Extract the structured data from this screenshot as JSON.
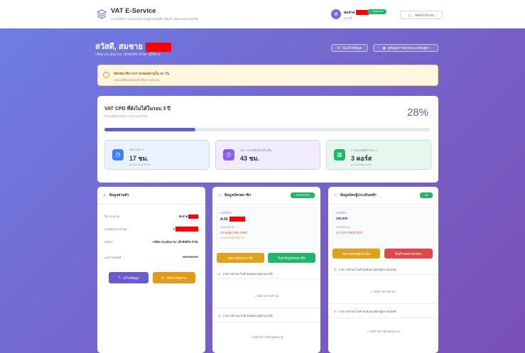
{
  "header": {
    "brand_title": "VAT E-Service",
    "brand_subtitle": "ระบบให้บริการออนไลน์สมาคมผู้สอบบัญชีภาษีมูลค่าเพิ่มแห่งประเทศไทย",
    "user_initial": "ส",
    "user_name": "สมชาย",
    "approved_badge": "✓ Approved",
    "user_role": "สมาชิก",
    "logout_label": "ออกจากระบบ"
  },
  "hero": {
    "greeting": "สวัสดี, สมชาย",
    "subtitle": "บริษัท ประเมินภาษา เอ็กซ์เพิร์ท จำกัด • ผู้ใช้งาน",
    "edit_btn": "ไปแก้ไขข้อมูล",
    "history_btn": "ดูข้อมูลการอบรมและหลักสูตร"
  },
  "alert": {
    "title": "บัตรสมาชิก VAT จะหมดอายุใน 62 วัน",
    "subtitle": "กรุณาเตรียมต่ออายุสำหรับการต่ออายุ"
  },
  "cpd": {
    "title": "VAT CPD ที่ยังไม่ได้ในรอบ 3 ปี",
    "subtitle": "ชั่วโมงที่สะสมได้ 17 จาก 60 ชั่วโมง",
    "percent_label": "28%",
    "progress_fraction": 0.28,
    "stats": [
      {
        "label": "VAT CPD ↗",
        "value": "17 ชม.",
        "note": "ดูรายละเอียดชั่วโมง"
      },
      {
        "label": "VAT CPD ที่ยังต้องเก็บเพิ่ม",
        "value": "43 ชม.",
        "note": ""
      },
      {
        "label": "การอบรมที่เข้าร่วม ↗",
        "value": "3 คอร์ส",
        "note": "ดูรายละเอียดคอร์ส"
      }
    ]
  },
  "personal": {
    "title": "ข้อมูลส่วนตัว",
    "rows": [
      {
        "label": "ชื่อ-นามสกุล",
        "value": "สมชาย"
      },
      {
        "label": "เลขบัตรประชาชน",
        "value": "3"
      },
      {
        "label": "องค์กร",
        "value": "บริษัท ประเมินภาษา เอ็กซ์เพิร์ท จำกัด"
      },
      {
        "label": "เบอร์โทรศัพท์",
        "value": "0899999999"
      }
    ],
    "edit_btn": "แก้ไขข้อมูล",
    "password_btn": "เปลี่ยนรหัสผ่าน"
  },
  "membership": {
    "title": "ข้อมูลบัตรสมาชิก",
    "status_pill": "APPROVED",
    "member_no_label": "เลขที่บัตร",
    "member_no": "A-65",
    "expiry_label": "วันหมดอายุ",
    "expiry": "10 พฤษภาคม 2569",
    "expiry_note": "จะหมดอายุใน 62 วัน",
    "renew_btn": "ต่ออายุบัตรสมาชิก",
    "print_btn": "ใบสำคัญบัตรสมาชิก",
    "history1": "รายการคำขอ ใบคำขอต่ออายุบัตรสมาชิก",
    "empty1": "ไม่มีรายการคำขอ",
    "history2": "รายการคำขอ ใบคำขอต่ออายุบัตรสมาชิก",
    "empty2": "ไม่มีรายการคำขอต่ออายุ"
  },
  "license": {
    "title": "ข้อมูลบัตรผู้ประเมินหลัก",
    "status_pill": "แท้",
    "card_no_label": "เลขที่บัตร",
    "card_no": "160,000",
    "expiry_label": "วันหมดอายุ",
    "expiry": "14 กุมภาพันธ์ 2570",
    "renew_btn": "ต่ออายุบัตรผู้ประเมิน",
    "cancel_btn": "ยื่นคำขอยกเลิกบัตร",
    "history1": "รายการคำขอ ใบคำขอต่ออายุบัตรผู้ประเมินหลัก",
    "empty1": "ไม่มีรายการคำขอ",
    "history2": "รายการคำขอ ใบคำขอต่ออายุบัตรผู้ประเมินหลัก",
    "empty2": "ไม่มีรายการคำขอต่ออายุ"
  },
  "colors": {
    "accent": "#5f62c4",
    "success": "#21b46a",
    "warning": "#e39a14",
    "danger": "#e04848"
  }
}
